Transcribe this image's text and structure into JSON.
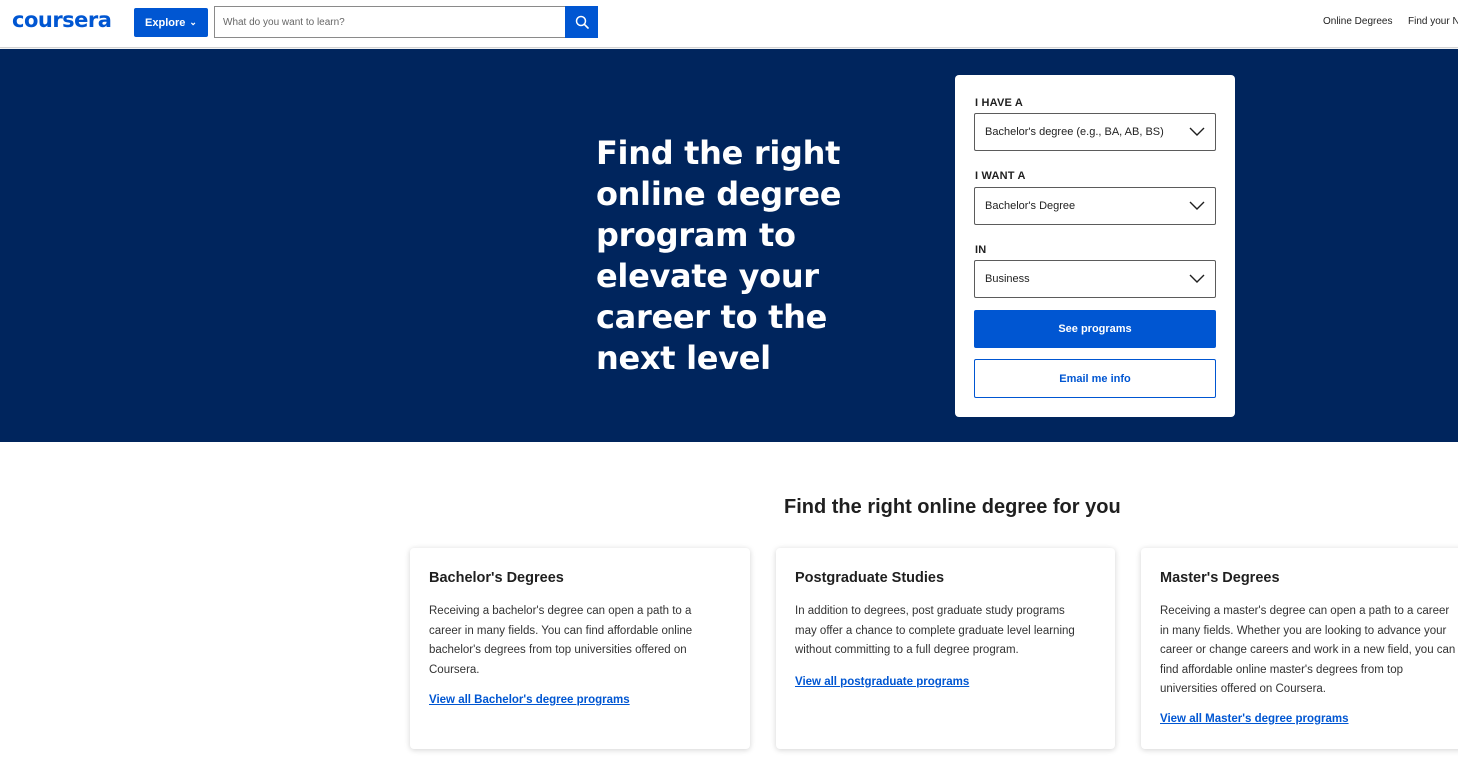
{
  "header": {
    "logo": "coursera",
    "explore_label": "Explore",
    "search_placeholder": "What do you want to learn?",
    "nav_online_degrees": "Online Degrees",
    "nav_find_your": "Find your N"
  },
  "hero": {
    "title": "Find the right online degree program to elevate your career to the next level",
    "form": {
      "have_label": "I HAVE A",
      "have_value": "Bachelor's degree (e.g., BA, AB, BS)",
      "want_label": "I WANT A",
      "want_value": "Bachelor's Degree",
      "in_label": "IN",
      "in_value": "Business",
      "see_programs": "See programs",
      "email_info": "Email me info"
    }
  },
  "section": {
    "title": "Find the right online degree for you",
    "cards": [
      {
        "title": "Bachelor's Degrees",
        "description": "Receiving a bachelor's degree can open a path to a career in many fields. You can find affordable online bachelor's degrees from top universities offered on Coursera.",
        "link": "View all Bachelor's degree programs"
      },
      {
        "title": "Postgraduate Studies",
        "description": "In addition to degrees, post graduate study programs may offer a chance to complete graduate level learning without committing to a full degree program.",
        "link": "View all postgraduate programs"
      },
      {
        "title": "Master's Degrees",
        "description": "Receiving a master's degree can open a path to a career in many fields. Whether you are looking to advance your career or change careers and work in a new field, you can find affordable online master's degrees from top universities offered on Coursera.",
        "link": "View all Master's degree programs"
      }
    ]
  },
  "colors": {
    "brand_blue": "#0056d2",
    "hero_navy": "#00255d"
  },
  "icons": {
    "search": "search-icon",
    "chevron": "chevron-down-icon"
  }
}
